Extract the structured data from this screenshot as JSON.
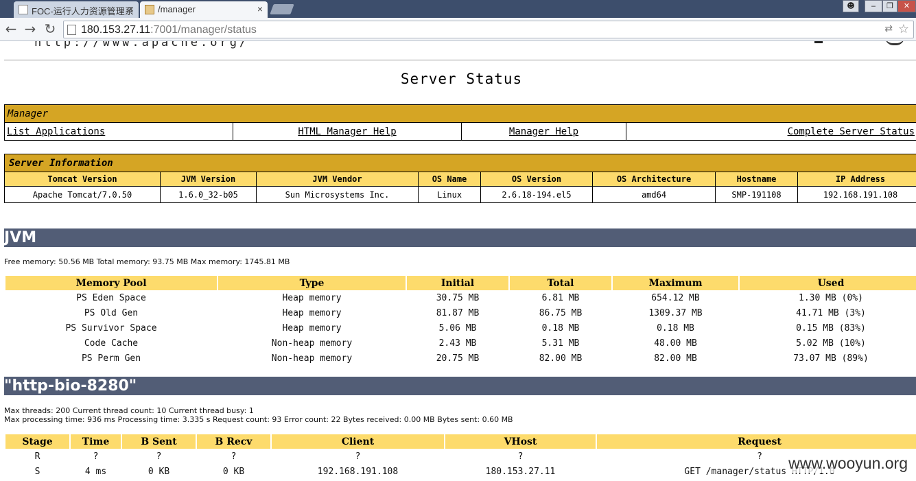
{
  "browser": {
    "tabs": [
      {
        "label": "FOC-运行人力资源管理系"
      },
      {
        "label": "/manager"
      }
    ],
    "address": {
      "host": "180.153.27.11",
      "rest": ":7001/manager/status"
    }
  },
  "page": {
    "apache_url": "http://www.apache.org/",
    "title": "Server Status",
    "manager": {
      "heading": "Manager",
      "links": [
        "List Applications",
        "HTML Manager Help",
        "Manager Help",
        "Complete Server Status"
      ]
    },
    "server_info": {
      "heading": "Server Information",
      "columns": [
        "Tomcat Version",
        "JVM Version",
        "JVM Vendor",
        "OS Name",
        "OS Version",
        "OS Architecture",
        "Hostname",
        "IP Address"
      ],
      "values": [
        "Apache Tomcat/7.0.50",
        "1.6.0_32-b05",
        "Sun Microsystems Inc.",
        "Linux",
        "2.6.18-194.el5",
        "amd64",
        "SMP-191108",
        "192.168.191.108"
      ]
    },
    "jvm": {
      "heading": "JVM",
      "memory_line": "Free memory: 50.56 MB Total memory: 93.75 MB Max memory: 1745.81 MB",
      "columns": [
        "Memory Pool",
        "Type",
        "Initial",
        "Total",
        "Maximum",
        "Used"
      ],
      "rows": [
        [
          "PS Eden Space",
          "Heap memory",
          "30.75 MB",
          "6.81 MB",
          "654.12 MB",
          "1.30 MB (0%)"
        ],
        [
          "PS Old Gen",
          "Heap memory",
          "81.87 MB",
          "86.75 MB",
          "1309.37 MB",
          "41.71 MB (3%)"
        ],
        [
          "PS Survivor Space",
          "Heap memory",
          "5.06 MB",
          "0.18 MB",
          "0.18 MB",
          "0.15 MB (83%)"
        ],
        [
          "Code Cache",
          "Non-heap memory",
          "2.43 MB",
          "5.31 MB",
          "48.00 MB",
          "5.02 MB (10%)"
        ],
        [
          "PS Perm Gen",
          "Non-heap memory",
          "20.75 MB",
          "82.00 MB",
          "82.00 MB",
          "73.07 MB (89%)"
        ]
      ]
    },
    "connector": {
      "heading": "\"http-bio-8280\"",
      "line1": "Max threads: 200 Current thread count: 10 Current thread busy: 1",
      "line2": "Max processing time: 936 ms Processing time: 3.335 s Request count: 93 Error count: 22 Bytes received: 0.00 MB Bytes sent: 0.60 MB",
      "columns": [
        "Stage",
        "Time",
        "B Sent",
        "B Recv",
        "Client",
        "VHost",
        "Request"
      ],
      "rows": [
        [
          "R",
          "?",
          "?",
          "?",
          "?",
          "?",
          "?"
        ],
        [
          "S",
          "4 ms",
          "0 KB",
          "0 KB",
          "192.168.191.108",
          "180.153.27.11",
          "GET /manager/status HTTP/1.0"
        ]
      ]
    }
  },
  "watermark": "www.wooyun.org"
}
